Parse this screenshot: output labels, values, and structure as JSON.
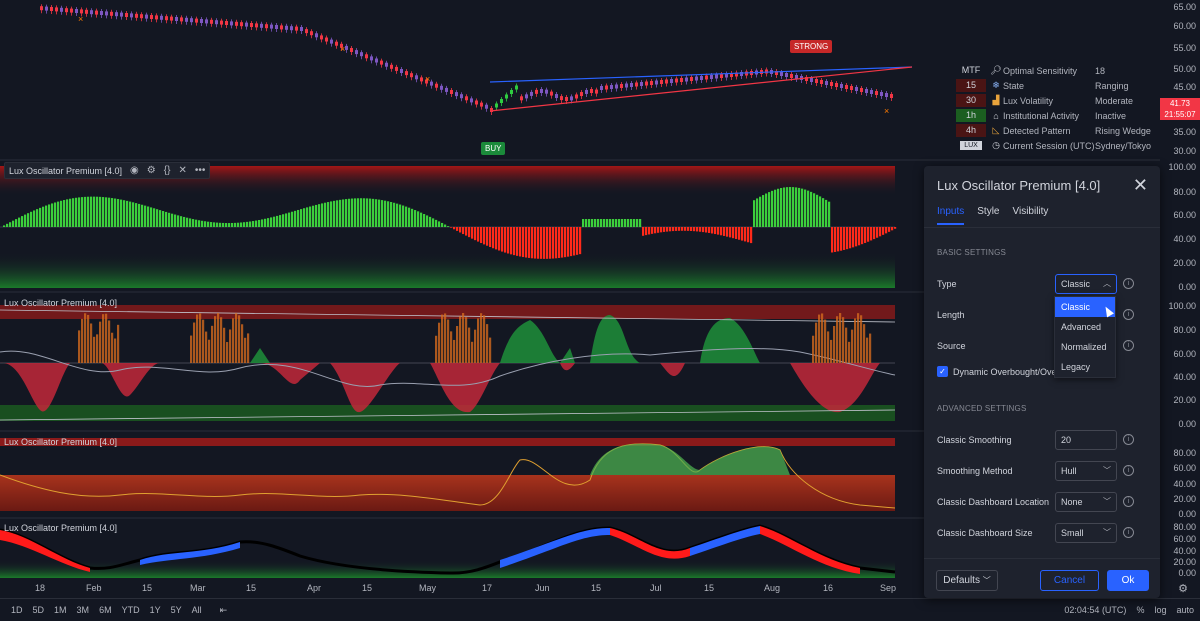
{
  "price_axis": {
    "main_ticks": [
      "65.00",
      "60.00",
      "55.00",
      "50.00",
      "45.00",
      "40.00",
      "35.00",
      "30.00"
    ],
    "last_price": "41.73",
    "countdown": "21:55:07",
    "osc1_ticks": [
      "100.00",
      "80.00",
      "60.00",
      "40.00",
      "20.00",
      "0.00"
    ],
    "osc2_ticks": [
      "100.00",
      "80.00",
      "60.00",
      "40.00",
      "20.00",
      "0.00"
    ],
    "osc3_ticks": [
      "80.00",
      "60.00",
      "40.00",
      "20.00",
      "0.00"
    ],
    "osc4_ticks": [
      "80.00",
      "60.00",
      "40.00",
      "20.00",
      "0.00"
    ]
  },
  "chart_labels": {
    "strong": "STRONG",
    "buy": "BUY"
  },
  "dashboard": {
    "header": "MTF",
    "rows": [
      {
        "tf": "",
        "icon": "magnifier-icon",
        "label": "Optimal Sensitivity",
        "value": "18"
      },
      {
        "tf": "15",
        "icon": "snowflake-icon",
        "label": "State",
        "value": "Ranging"
      },
      {
        "tf": "30",
        "icon": "chart-icon",
        "label": "Lux Volatility",
        "value": "Moderate"
      },
      {
        "tf": "1h",
        "icon": "bank-icon",
        "label": "Institutional Activity",
        "value": "Inactive"
      },
      {
        "tf": "4h",
        "icon": "triangle-ruler-icon",
        "label": "Detected Pattern",
        "value": "Rising Wedge"
      },
      {
        "tf": "LUX",
        "icon": "clock-icon",
        "label": "Current Session (UTC)",
        "value": "Sydney/Tokyo"
      }
    ],
    "colors": {
      "tf15": "#4a1414",
      "tf30": "#4a1414",
      "tf1h": "#1b5e20",
      "tf4h": "#4a1414"
    }
  },
  "panes": [
    {
      "label": "Lux Oscillator Premium [4.0]"
    },
    {
      "label": "Lux Oscillator Premium [4.0]"
    },
    {
      "label": "Lux Oscillator Premium [4.0]"
    },
    {
      "label": "Lux Oscillator Premium [4.0]"
    }
  ],
  "date_axis": [
    "18",
    "Feb",
    "15",
    "Mar",
    "15",
    "Apr",
    "15",
    "May",
    "17",
    "Jun",
    "15",
    "Jul",
    "15",
    "Aug",
    "16",
    "Sep"
  ],
  "bottom_bar": {
    "timeframes": [
      "1D",
      "5D",
      "1M",
      "3M",
      "6M",
      "YTD",
      "1Y",
      "5Y",
      "All"
    ],
    "clock": "02:04:54 (UTC)",
    "percent": "%",
    "log": "log",
    "auto": "auto"
  },
  "dialog": {
    "title": "Lux Oscillator Premium [4.0]",
    "tabs": [
      "Inputs",
      "Style",
      "Visibility"
    ],
    "basic_header": "BASIC SETTINGS",
    "type_label": "Type",
    "type_value": "Classic",
    "type_options": [
      "Classic",
      "Advanced",
      "Normalized",
      "Legacy"
    ],
    "length_label": "Length",
    "source_label": "Source",
    "dynamic_label": "Dynamic Overbought/Ove",
    "advanced_header": "ADVANCED SETTINGS",
    "classic_smoothing_label": "Classic Smoothing",
    "classic_smoothing_value": "20",
    "smoothing_method_label": "Smoothing Method",
    "smoothing_method_value": "Hull",
    "dashboard_location_label": "Classic Dashboard Location",
    "dashboard_location_value": "None",
    "dashboard_size_label": "Classic Dashboard Size",
    "dashboard_size_value": "Small",
    "defaults_label": "Defaults",
    "cancel_label": "Cancel",
    "ok_label": "Ok"
  }
}
